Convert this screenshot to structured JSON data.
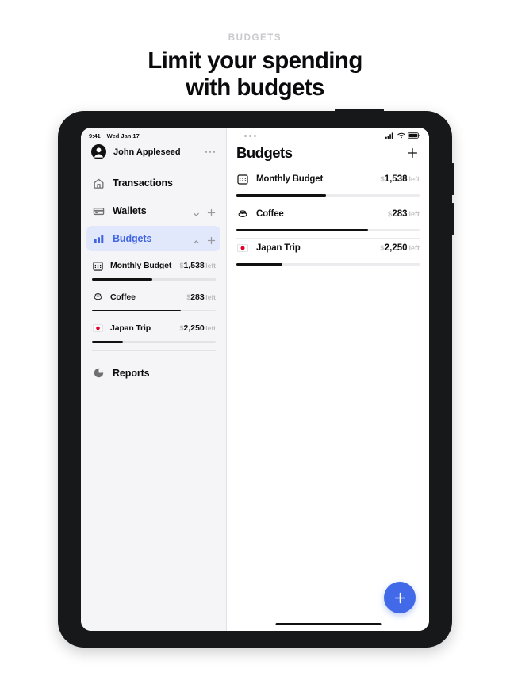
{
  "marketing": {
    "kicker": "BUDGETS",
    "headline_line1": "Limit your spending",
    "headline_line2": "with budgets"
  },
  "status_bar": {
    "time": "9:41",
    "date": "Wed Jan 17",
    "cellular_icon": "signal-bars-icon",
    "wifi_icon": "wifi-icon",
    "battery_icon": "battery-icon"
  },
  "sidebar": {
    "profile": {
      "name": "John Appleseed",
      "avatar_icon": "person-circle-icon",
      "more_icon": "ellipsis-icon"
    },
    "nav_items": [
      {
        "label": "Transactions",
        "icon": "house-icon",
        "active": false,
        "has_chevron": false,
        "has_plus": false
      },
      {
        "label": "Wallets",
        "icon": "card-icon",
        "active": false,
        "has_chevron": true,
        "chevron": "chevron-down-icon",
        "has_plus": true
      },
      {
        "label": "Budgets",
        "icon": "bar-chart-icon",
        "active": true,
        "has_chevron": true,
        "chevron": "chevron-up-icon",
        "has_plus": true
      }
    ],
    "budget_items": [
      {
        "name": "Monthly Budget",
        "icon": "calendar-icon",
        "currency": "$",
        "amount": "1,538",
        "suffix": "left",
        "progress": 49
      },
      {
        "name": "Coffee",
        "icon": "coffee-cup-icon",
        "currency": "$",
        "amount": "283",
        "suffix": "left",
        "progress": 72
      },
      {
        "name": "Japan Trip",
        "icon": "japan-flag-icon",
        "currency": "$",
        "amount": "2,250",
        "suffix": "left",
        "progress": 25
      }
    ],
    "footer_item": {
      "label": "Reports",
      "icon": "pie-chart-icon"
    }
  },
  "main": {
    "multitask_icon": "multitask-dots-icon",
    "title": "Budgets",
    "add_icon": "plus-icon",
    "budget_rows": [
      {
        "name": "Monthly Budget",
        "icon": "calendar-icon",
        "currency": "$",
        "amount": "1,538",
        "suffix": "left",
        "progress": 49
      },
      {
        "name": "Coffee",
        "icon": "coffee-cup-icon",
        "currency": "$",
        "amount": "283",
        "suffix": "left",
        "progress": 72
      },
      {
        "name": "Japan Trip",
        "icon": "japan-flag-icon",
        "currency": "$",
        "amount": "2,250",
        "suffix": "left",
        "progress": 25
      }
    ],
    "fab_icon": "plus-icon"
  },
  "colors": {
    "accent": "#4169e8",
    "accent_bg": "#e2e8fb",
    "sidebar_bg": "#f5f5f7",
    "text": "#0b0b0d",
    "muted": "#c2c2c7"
  }
}
